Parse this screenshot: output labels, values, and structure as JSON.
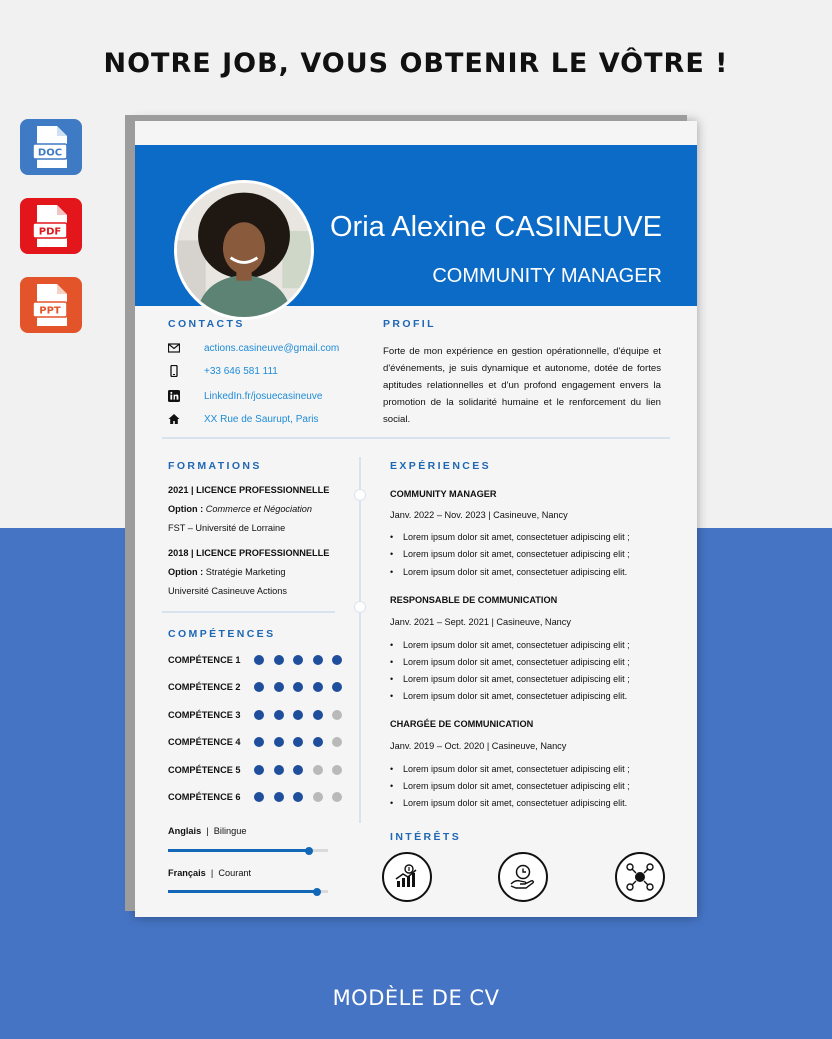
{
  "headline": "NOTRE JOB, VOUS OBTENIR LE VÔTRE !",
  "footer": "MODÈLE DE CV",
  "formats": [
    {
      "label": "DOC",
      "color": "#3f7ac4"
    },
    {
      "label": "PDF",
      "color": "#e3161c"
    },
    {
      "label": "PPT",
      "color": "#e3542a"
    }
  ],
  "cv": {
    "name": "Oria Alexine CASINEUVE",
    "role": "COMMUNITY MANAGER",
    "accent": "#0c6bc6",
    "contacts": {
      "title": "CONTACTS",
      "email": "actions.casineuve@gmail.com",
      "phone": "+33 646 581 111",
      "linkedin": "LinkedIn.fr/josuecasineuve",
      "address": "XX Rue de Saurupt, Paris"
    },
    "profil": {
      "title": "PROFIL",
      "text": "Forte de mon expérience en gestion opérationnelle, d'équipe et d'événements, je suis dynamique et autonome, dotée de fortes aptitudes relationnelles et d'un profond engagement envers la promotion de la solidarité humaine et le renforcement du lien social."
    },
    "formations": {
      "title": "FORMATIONS",
      "items": [
        {
          "heading": "2021 | LICENCE PROFESSIONNELLE",
          "option_label": "Option :",
          "option_value": "Commerce et Négociation",
          "school": "FST – Université de Lorraine"
        },
        {
          "heading": "2018 | LICENCE PROFESSIONNELLE",
          "option_label": "Option :",
          "option_value": "Stratégie Marketing",
          "school": "Université Casineuve Actions"
        }
      ]
    },
    "competences": {
      "title": "COMPÉTENCES",
      "items": [
        {
          "label": "COMPÉTENCE 1",
          "level": 5
        },
        {
          "label": "COMPÉTENCE 2",
          "level": 5
        },
        {
          "label": "COMPÉTENCE 3",
          "level": 4
        },
        {
          "label": "COMPÉTENCE 4",
          "level": 4
        },
        {
          "label": "COMPÉTENCE 5",
          "level": 3
        },
        {
          "label": "COMPÉTENCE 6",
          "level": 3
        }
      ],
      "max": 5
    },
    "langues": [
      {
        "name": "Anglais",
        "level_text": "Bilingue",
        "level_fraction": 0.88
      },
      {
        "name": "Français",
        "level_text": "Courant",
        "level_fraction": 0.93
      }
    ],
    "experiences": {
      "title": "EXPÉRIENCES",
      "items": [
        {
          "title": "COMMUNITY MANAGER",
          "meta": "Janv. 2022 – Nov. 2023 | Casineuve, Nancy",
          "bullets": [
            "Lorem ipsum dolor sit amet, consectetuer adipiscing elit ;",
            "Lorem ipsum dolor sit amet, consectetuer adipiscing elit ;",
            "Lorem ipsum dolor sit amet, consectetuer adipiscing elit."
          ]
        },
        {
          "title": "RESPONSABLE DE COMMUNICATION",
          "meta": "Janv. 2021 – Sept. 2021 | Casineuve, Nancy",
          "bullets": [
            "Lorem ipsum dolor sit amet, consectetuer adipiscing elit ;",
            "Lorem ipsum dolor sit amet, consectetuer adipiscing elit ;",
            "Lorem ipsum dolor sit amet, consectetuer adipiscing elit ;",
            "Lorem ipsum dolor sit amet, consectetuer adipiscing elit."
          ]
        },
        {
          "title": "CHARGÉE DE COMMUNICATION",
          "meta": "Janv. 2019 – Oct. 2020 | Casineuve, Nancy",
          "bullets": [
            "Lorem ipsum dolor sit amet, consectetuer adipiscing elit ;",
            "Lorem ipsum dolor sit amet, consectetuer adipiscing elit ;",
            "Lorem ipsum dolor sit amet, consectetuer adipiscing elit."
          ]
        }
      ]
    },
    "interets": {
      "title": "INTÉRÊTS",
      "icons": [
        "finance-growth-icon",
        "time-money-hand-icon",
        "network-people-icon"
      ]
    }
  }
}
